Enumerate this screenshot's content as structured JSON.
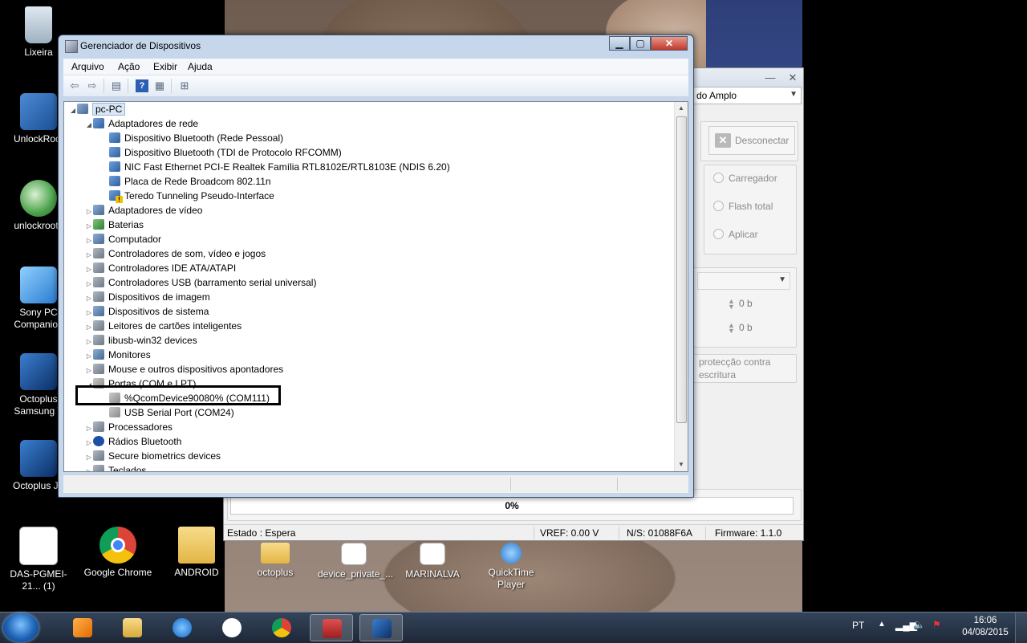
{
  "desktop_icons": [
    {
      "label": "Lixeira"
    },
    {
      "label": "UnlockRoot"
    },
    {
      "label": "unlockroots"
    },
    {
      "label": "Sony PC Companion"
    },
    {
      "label": "Octoplus Samsung T"
    },
    {
      "label": "Octoplus JT"
    },
    {
      "label": "DAS-PGMEI-21... (1)"
    },
    {
      "label": "Google Chrome"
    },
    {
      "label": "ANDROID"
    },
    {
      "label": "octoplus"
    },
    {
      "label": "device_private_..."
    },
    {
      "label": "MARINALVA"
    },
    {
      "label": "QuickTime Player"
    }
  ],
  "octoplus": {
    "mode_combo": "do Amplo",
    "disconnect_label": "Desconectar",
    "radios": [
      "Carregador",
      "Flash total",
      "Aplicar"
    ],
    "spin1": "0 b",
    "spin2": "0 b",
    "protect_text": "protecção contra escritura",
    "progress_text": "0%",
    "status": {
      "state": "Estado : Espera",
      "vref": "VREF: 0.00 V",
      "serial": "N/S: 01088F6A",
      "firmware": "Firmware: 1.1.0"
    }
  },
  "device_manager": {
    "title": "Gerenciador de Dispositivos",
    "menu": [
      "Arquivo",
      "Ação",
      "Exibir",
      "Ajuda"
    ],
    "root": "pc-PC",
    "network_category": "Adaptadores de rede",
    "network_children": [
      "Dispositivo Bluetooth (Rede Pessoal)",
      "Dispositivo Bluetooth (TDI de Protocolo RFCOMM)",
      "NIC Fast Ethernet PCI-E Realtek Família RTL8102E/RTL8103E (NDIS 6.20)",
      "Placa de Rede Broadcom 802.11n",
      "Teredo Tunneling Pseudo-Interface"
    ],
    "categories_a": [
      "Adaptadores de vídeo",
      "Baterias",
      "Computador",
      "Controladores de som, vídeo e jogos",
      "Controladores IDE ATA/ATAPI",
      "Controladores USB (barramento serial universal)",
      "Dispositivos de imagem",
      "Dispositivos de sistema",
      "Leitores de cartões inteligentes",
      "libusb-win32 devices",
      "Monitores",
      "Mouse e outros dispositivos apontadores"
    ],
    "ports_category": "Portas (COM e LPT)",
    "ports_children": [
      "%QcomDevice90080% (COM111)",
      "USB Serial Port (COM24)"
    ],
    "categories_b": [
      "Processadores",
      "Rádios Bluetooth",
      "Secure biometrics devices",
      "Teclados"
    ]
  },
  "taskbar": {
    "language": "PT",
    "time": "16:06",
    "date": "04/08/2015"
  }
}
